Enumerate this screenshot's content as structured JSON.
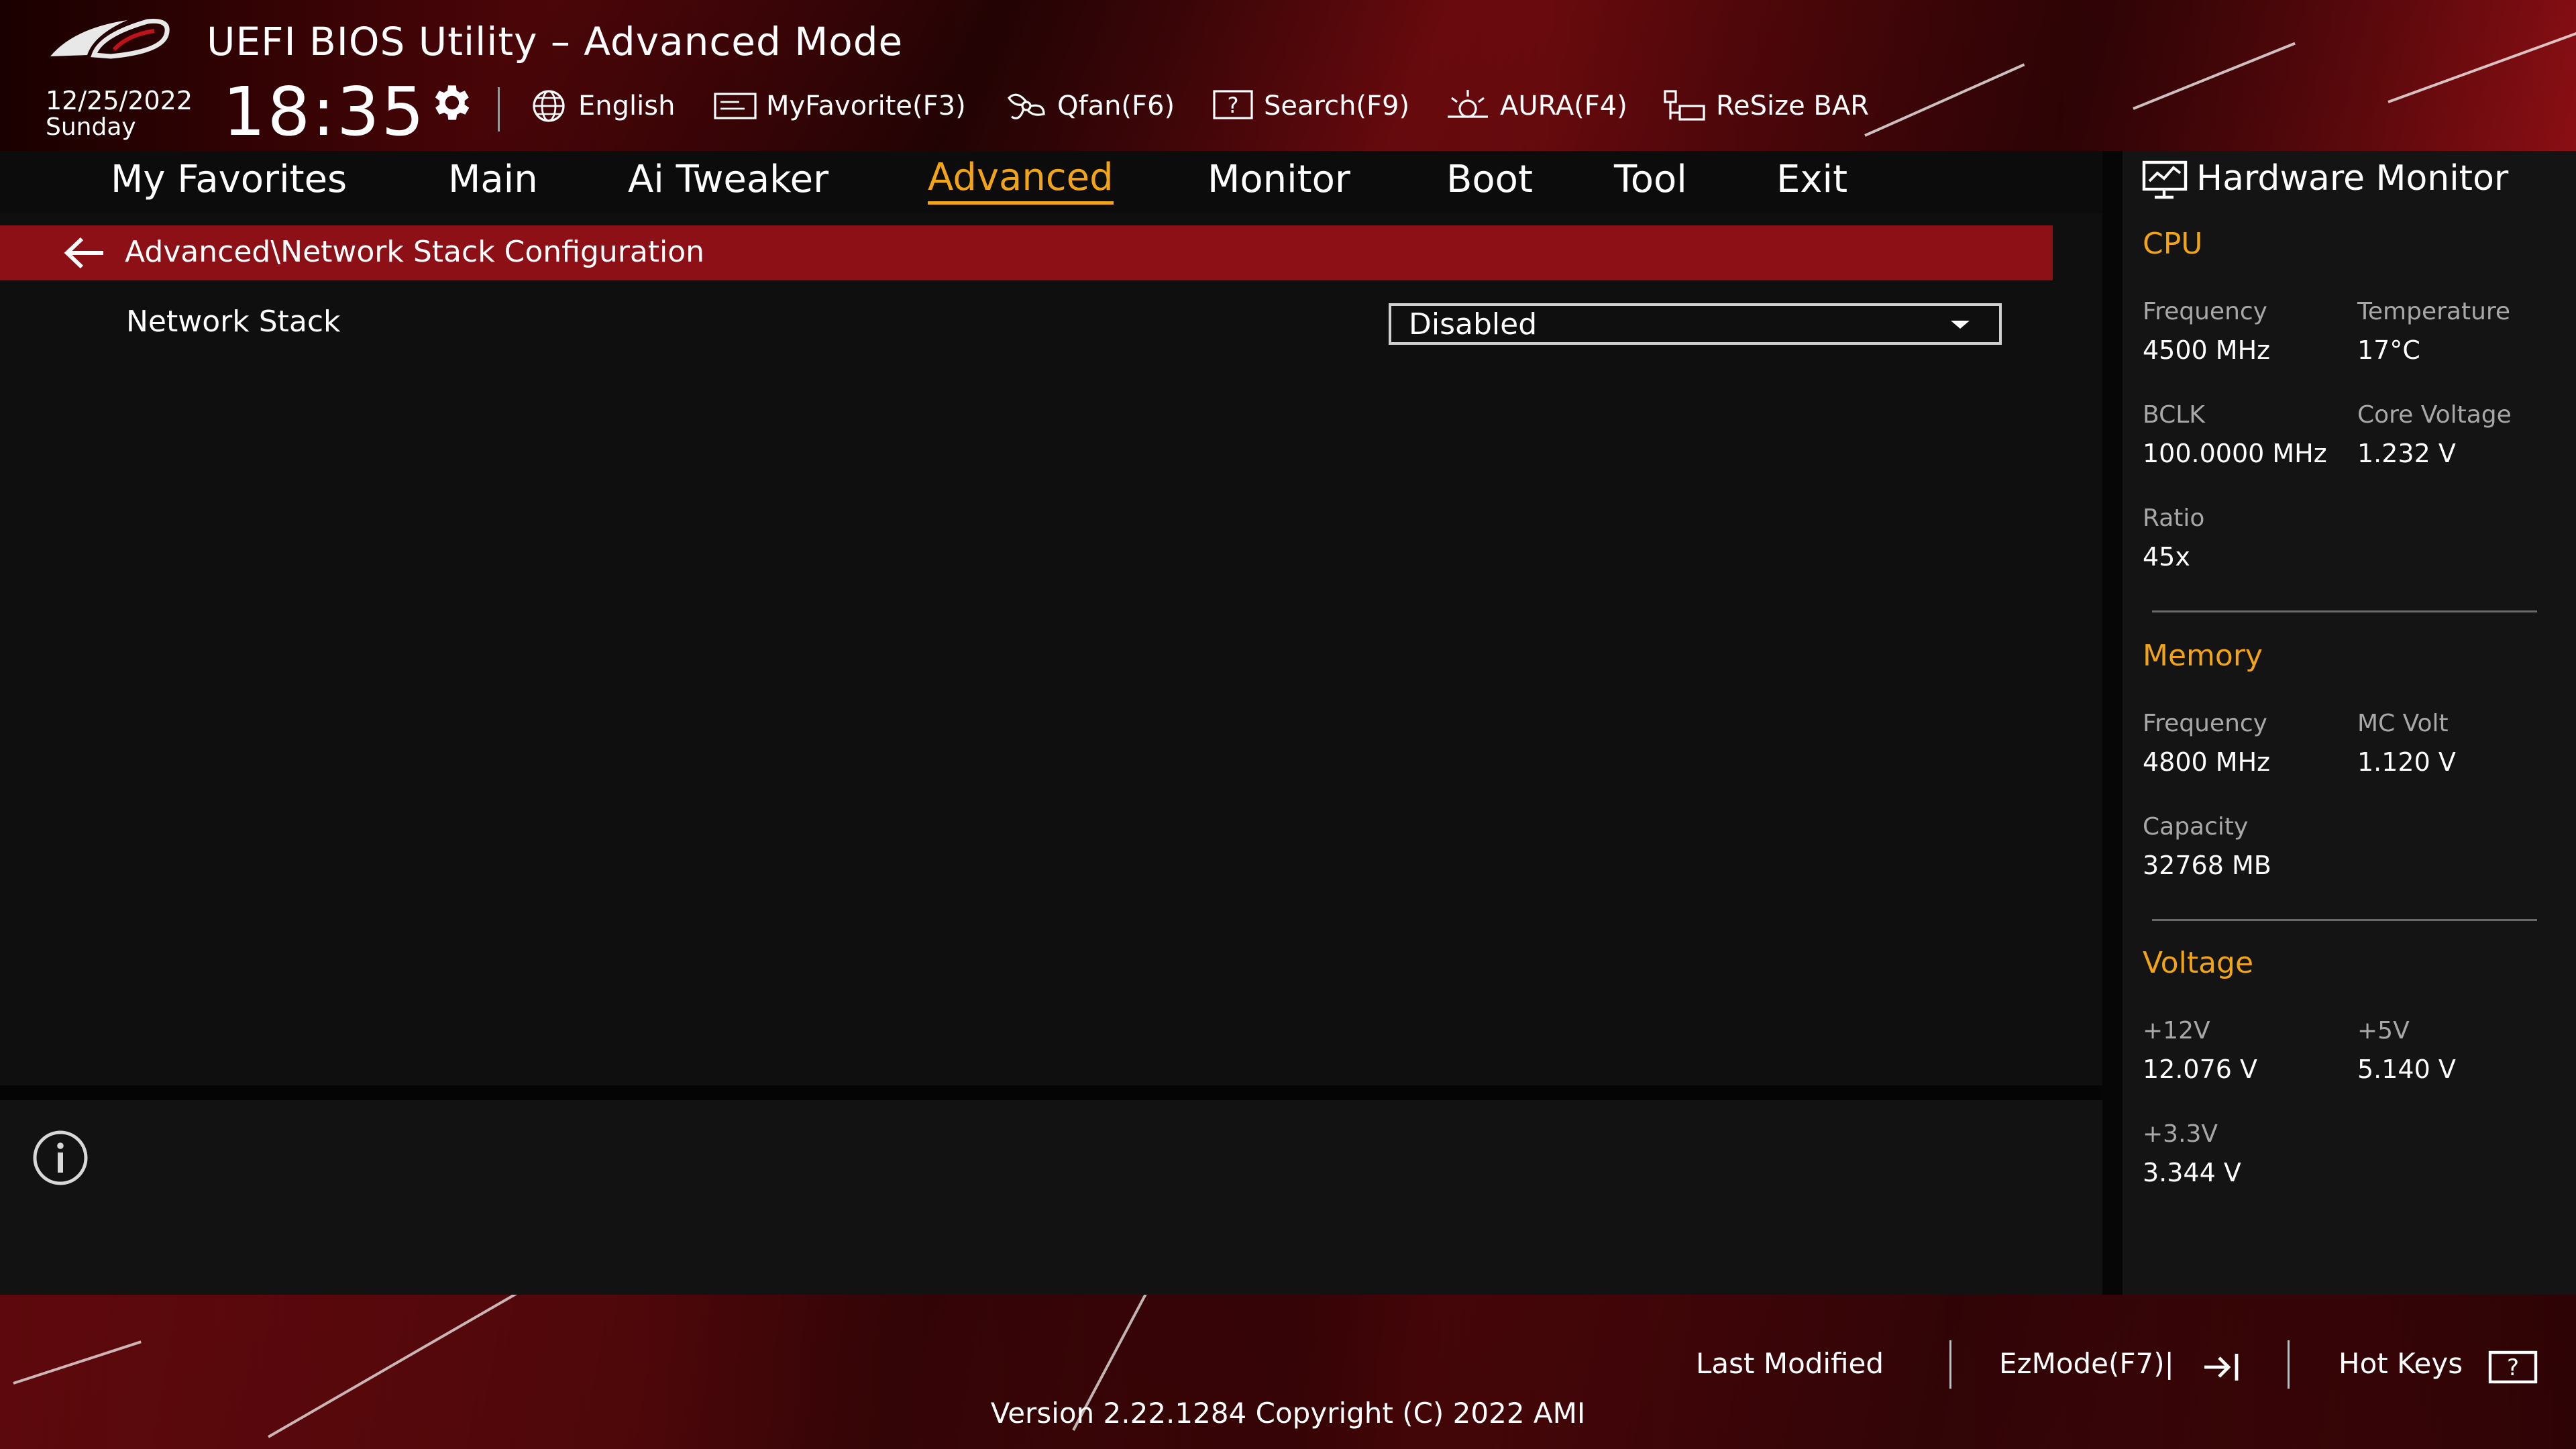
{
  "header": {
    "title": "UEFI BIOS Utility – Advanced Mode",
    "date": "12/25/2022",
    "day": "Sunday",
    "time": "18:35",
    "logo": "rog-logo",
    "toolbar": [
      {
        "label": "English",
        "icon": "globe-icon"
      },
      {
        "label": "MyFavorite(F3)",
        "icon": "favorite-icon"
      },
      {
        "label": "Qfan(F6)",
        "icon": "fan-icon"
      },
      {
        "label": "Search(F9)",
        "icon": "search-help-icon"
      },
      {
        "label": "AURA(F4)",
        "icon": "aura-icon"
      },
      {
        "label": "ReSize BAR",
        "icon": "resize-bar-icon"
      }
    ]
  },
  "nav": {
    "active": "Advanced",
    "tabs": [
      "My Favorites",
      "Main",
      "Ai Tweaker",
      "Advanced",
      "Monitor",
      "Boot",
      "Tool",
      "Exit"
    ]
  },
  "main": {
    "breadcrumb": "Advanced\\Network Stack Configuration",
    "settings": [
      {
        "label": "Network Stack",
        "value": "Disabled"
      }
    ]
  },
  "hardware_monitor": {
    "title": "Hardware Monitor",
    "cpu": {
      "section": "CPU",
      "frequency_label": "Frequency",
      "frequency": "4500 MHz",
      "temperature_label": "Temperature",
      "temperature": "17°C",
      "bclk_label": "BCLK",
      "bclk": "100.0000 MHz",
      "core_voltage_label": "Core Voltage",
      "core_voltage": "1.232 V",
      "ratio_label": "Ratio",
      "ratio": "45x"
    },
    "memory": {
      "section": "Memory",
      "frequency_label": "Frequency",
      "frequency": "4800 MHz",
      "mc_volt_label": "MC Volt",
      "mc_volt": "1.120 V",
      "capacity_label": "Capacity",
      "capacity": "32768 MB"
    },
    "voltage": {
      "section": "Voltage",
      "v12_label": "+12V",
      "v12": "12.076 V",
      "v5_label": "+5V",
      "v5": "5.140 V",
      "v33_label": "+3.3V",
      "v33": "3.344 V"
    }
  },
  "footer": {
    "last_modified": "Last Modified",
    "ezmode": "EzMode(F7)|",
    "hotkeys": "Hot Keys",
    "version": "Version 2.22.1284 Copyright (C) 2022 AMI"
  },
  "colors": {
    "accent": "#f2a417",
    "breadcrumb_bar": "#8c1016",
    "background": "#0f0f0f"
  }
}
